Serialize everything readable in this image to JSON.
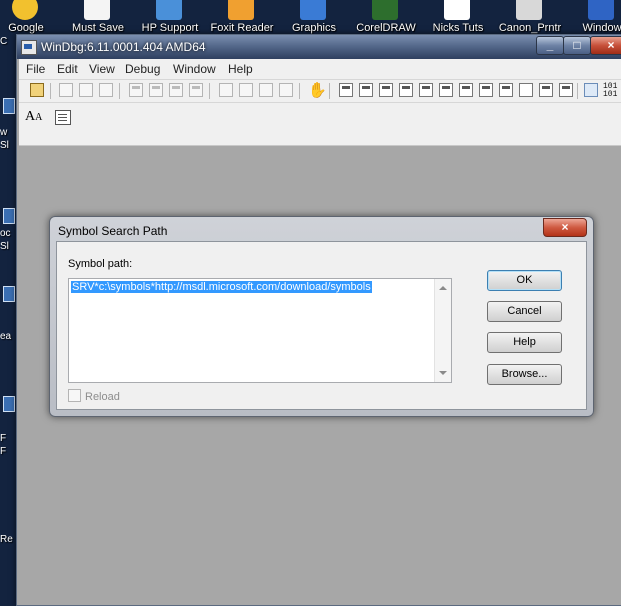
{
  "desktop": {
    "icons": [
      {
        "label": "Google",
        "color": "#f2c12e"
      },
      {
        "label": "Must Save",
        "color": "#f0f0f0"
      },
      {
        "label": "HP Support",
        "color": "#4a90d9"
      },
      {
        "label": "Foxit Reader",
        "color": "#f0a030"
      },
      {
        "label": "Graphics",
        "color": "#3a7bd5"
      },
      {
        "label": "CorelDRAW",
        "color": "#2d6e2d"
      },
      {
        "label": "Nicks Tuts",
        "color": "#ffffff"
      },
      {
        "label": "Canon_Prntr",
        "color": "#d8d8d8"
      },
      {
        "label": "Window",
        "color": "#2f64c4"
      }
    ],
    "left_strip": [
      "C",
      "w",
      "Sl",
      "oc",
      "Sl",
      "ea",
      "F",
      "F",
      "Re"
    ]
  },
  "window": {
    "title": "WinDbg:6.11.0001.404 AMD64",
    "controls": {
      "minimize": "_",
      "maximize": "□",
      "close": "×"
    },
    "menu": [
      "File",
      "Edit",
      "View",
      "Debug",
      "Window",
      "Help"
    ],
    "toolbar": {
      "binary_label_top": "101",
      "binary_label_bottom": "101"
    },
    "font_button": {
      "big": "A",
      "small": "A"
    }
  },
  "dialog": {
    "title": "Symbol Search Path",
    "close": "×",
    "label": "Symbol path:",
    "path_value": "SRV*c:\\symbols*http://msdl.microsoft.com/download/symbols",
    "reload_label": "Reload",
    "reload_checked": false,
    "buttons": {
      "ok": "OK",
      "cancel": "Cancel",
      "help": "Help",
      "browse": "Browse..."
    }
  }
}
